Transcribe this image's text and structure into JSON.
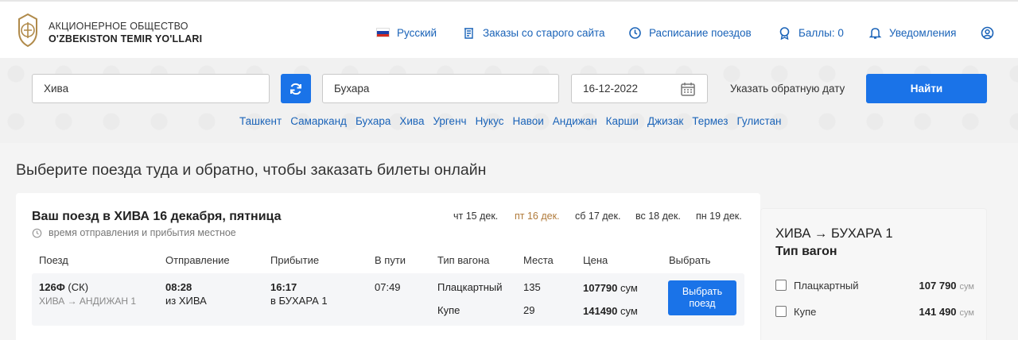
{
  "header": {
    "org_line1": "Акционерное общество",
    "org_line2": "O'ZBEKISTON TEMIR YO'LLARI",
    "nav": {
      "language": "Русский",
      "old_orders": "Заказы со старого сайта",
      "schedule": "Расписание поездов",
      "points": "Баллы: 0",
      "notifications": "Уведомления"
    },
    "flag_colors": [
      "#ffffff",
      "#1c3fa8",
      "#d52b1e"
    ],
    "icons": [
      "russian-flag-icon",
      "archive-icon",
      "clock-icon",
      "medal-icon",
      "bell-icon",
      "user-icon"
    ]
  },
  "search": {
    "from": "Хива",
    "to": "Бухара",
    "date": "16-12-2022",
    "return_date_label": "Указать обратную дату",
    "find_button": "Найти",
    "quick_cities": [
      "Ташкент",
      "Самарканд",
      "Бухара",
      "Хива",
      "Ургенч",
      "Нукус",
      "Навои",
      "Андижан",
      "Карши",
      "Джизак",
      "Термез",
      "Гулистан"
    ]
  },
  "page_title": "Выберите поезда туда и обратно, чтобы заказать билеты онлайн",
  "trains": {
    "title": "Ваш поезд в ХИВА 16 декабря, пятница",
    "note": "время отправления и прибытия местное",
    "dates": [
      "чт 15 дек.",
      "пт 16 дек.",
      "сб 17 дек.",
      "вс 18 дек.",
      "пн 19 дек."
    ],
    "active_date_color": "#b07a3a",
    "columns": [
      "Поезд",
      "Отправление",
      "Прибытие",
      "В пути",
      "Тип вагона",
      "Места",
      "Цена",
      "Выбрать"
    ],
    "rows": [
      {
        "number": "126Ф",
        "type": "(СК)",
        "route": "ХИВА → АНДИЖАН 1",
        "departure_time": "08:28",
        "departure_station": "из ХИВА",
        "arrival_time": "16:17",
        "arrival_station": "в БУХАРА 1",
        "duration": "07:49",
        "cars": [
          {
            "type": "Плацкартный",
            "seats": "135",
            "price": "107790",
            "currency": "сум"
          },
          {
            "type": "Купе",
            "seats": "29",
            "price": "141490",
            "currency": "сум"
          }
        ],
        "select_label_1": "Выбрать",
        "select_label_2": "поезд"
      }
    ]
  },
  "sidebar": {
    "route": "ХИВА → БУХАРА 1",
    "heading": "Тип вагон",
    "options": [
      {
        "label": "Плацкартный",
        "price": "107 790",
        "currency": "сум"
      },
      {
        "label": "Купе",
        "price": "141 490",
        "currency": "сум"
      }
    ]
  },
  "colors": {
    "accent": "#1a73e8",
    "link": "#1a63b8"
  }
}
